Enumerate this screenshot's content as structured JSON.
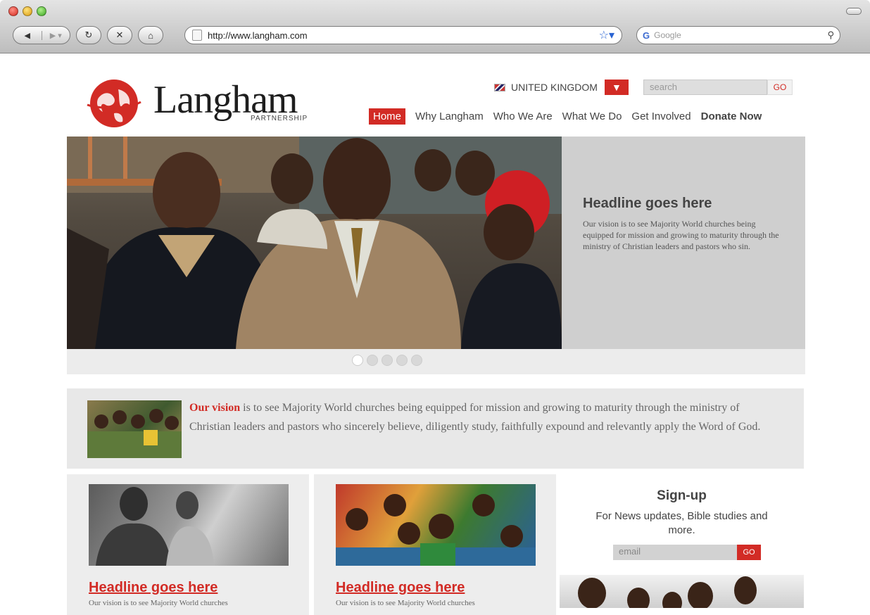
{
  "browser": {
    "url": "http://www.langham.com",
    "search_placeholder": "Google",
    "search_engine_label": "G"
  },
  "site": {
    "logo_word": "Langham",
    "logo_sub": "PARTNERSHIP",
    "region": "UNITED KINGDOM",
    "search_placeholder": "search",
    "search_go": "GO",
    "nav": [
      {
        "label": "Home",
        "active": true
      },
      {
        "label": "Why Langham"
      },
      {
        "label": "Who We Are"
      },
      {
        "label": "What We Do"
      },
      {
        "label": "Get Involved"
      },
      {
        "label": "Donate Now"
      }
    ],
    "brand_color": "#d22b25"
  },
  "hero": {
    "title": "Headline goes here",
    "text": "Our vision is to see Majority World churches being equipped for mission and growing to maturity through the ministry of Christian leaders and pastors who sin.",
    "slides": 5,
    "active_slide": 0
  },
  "vision": {
    "highlight": "Our vision",
    "text": " is to see Majority World churches being equipped for mission and growing to maturity through the ministry of Christian leaders and pastors who sincerely believe, diligently study, faithfully expound and relevantly apply the Word of God."
  },
  "cards": [
    {
      "title": "Headline goes here",
      "text": "Our vision is to see Majority World churches"
    },
    {
      "title": "Headline goes here",
      "text": "Our vision is to see Majority World churches"
    }
  ],
  "signup": {
    "title": "Sign-up",
    "text": "For News updates, Bible studies and more.",
    "placeholder": "email",
    "go": "GO"
  }
}
